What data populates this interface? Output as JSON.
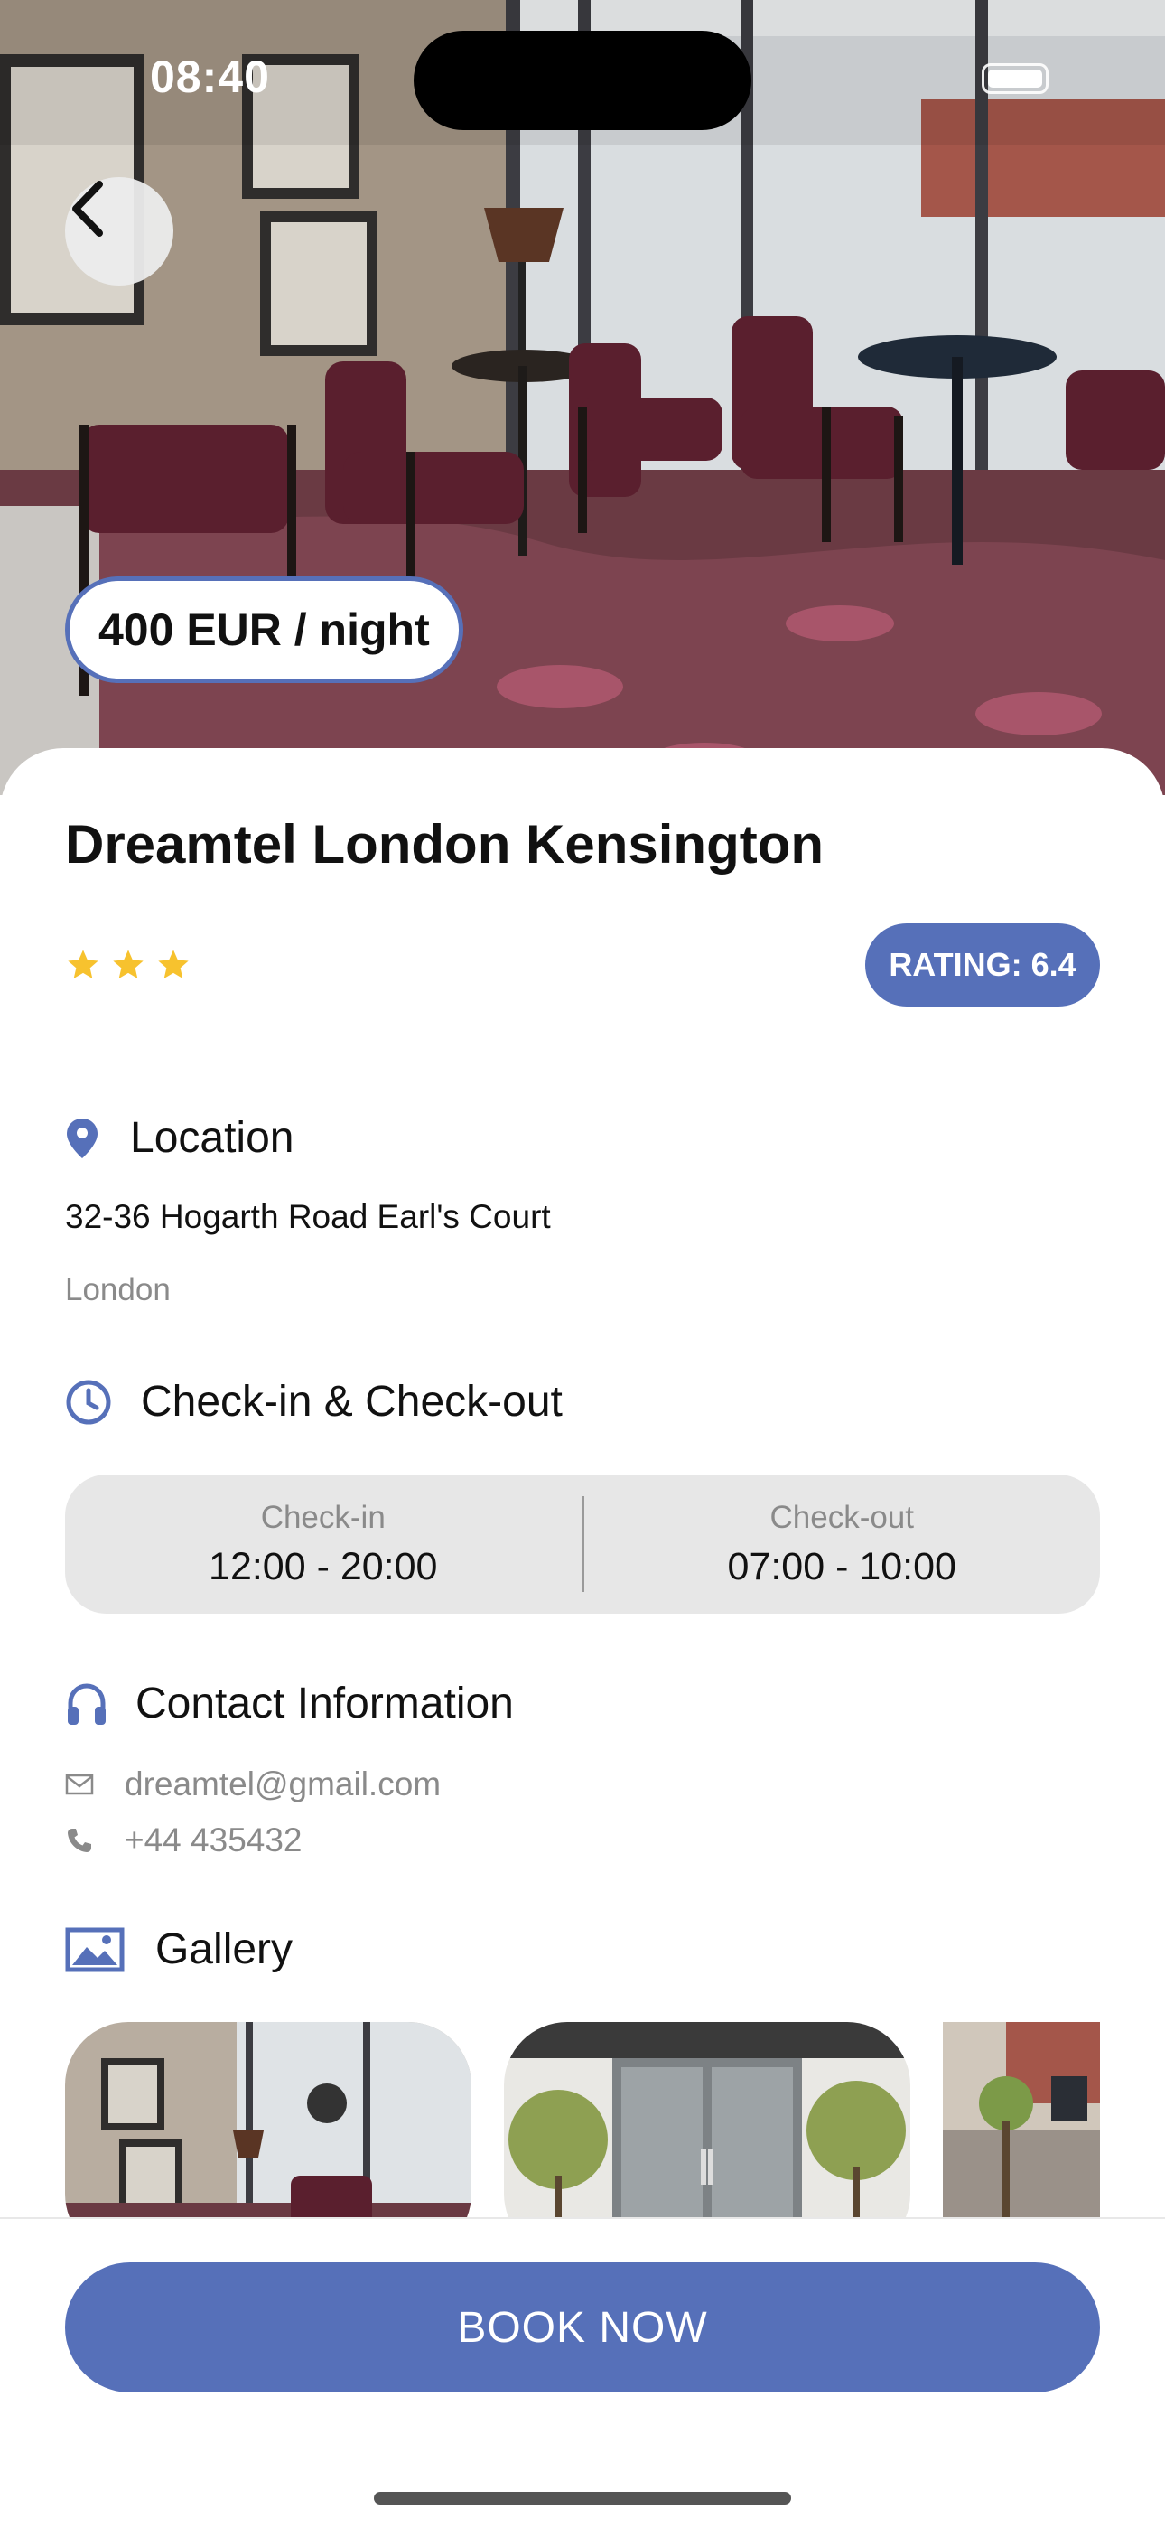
{
  "status_bar": {
    "time": "08:40"
  },
  "hero": {
    "price_label": "400 EUR / night"
  },
  "hotel": {
    "name": "Dreamtel London Kensington",
    "stars": 3,
    "rating_label": "RATING: 6.4"
  },
  "location": {
    "heading": "Location",
    "address_line": "32-36 Hogarth Road Earl's Court",
    "city": "London"
  },
  "checkin": {
    "heading": "Check-in & Check-out",
    "checkin_label": "Check-in",
    "checkin_time": "12:00 - 20:00",
    "checkout_label": "Check-out",
    "checkout_time": "07:00 - 10:00"
  },
  "contact": {
    "heading": "Contact Information",
    "email": "dreamtel@gmail.com",
    "phone": "+44 435432"
  },
  "gallery": {
    "heading": "Gallery"
  },
  "actions": {
    "book_label": "BOOK NOW"
  },
  "colors": {
    "accent": "#5670b9",
    "star": "#f7c22e",
    "muted_text": "#8a8a8a",
    "panel_bg": "#e7e7e7"
  },
  "icons": {
    "back": "chevron-left-icon",
    "location": "map-pin-icon",
    "checkin": "clock-icon",
    "contact": "headphones-icon",
    "email": "envelope-icon",
    "phone": "phone-icon",
    "gallery": "image-icon"
  }
}
